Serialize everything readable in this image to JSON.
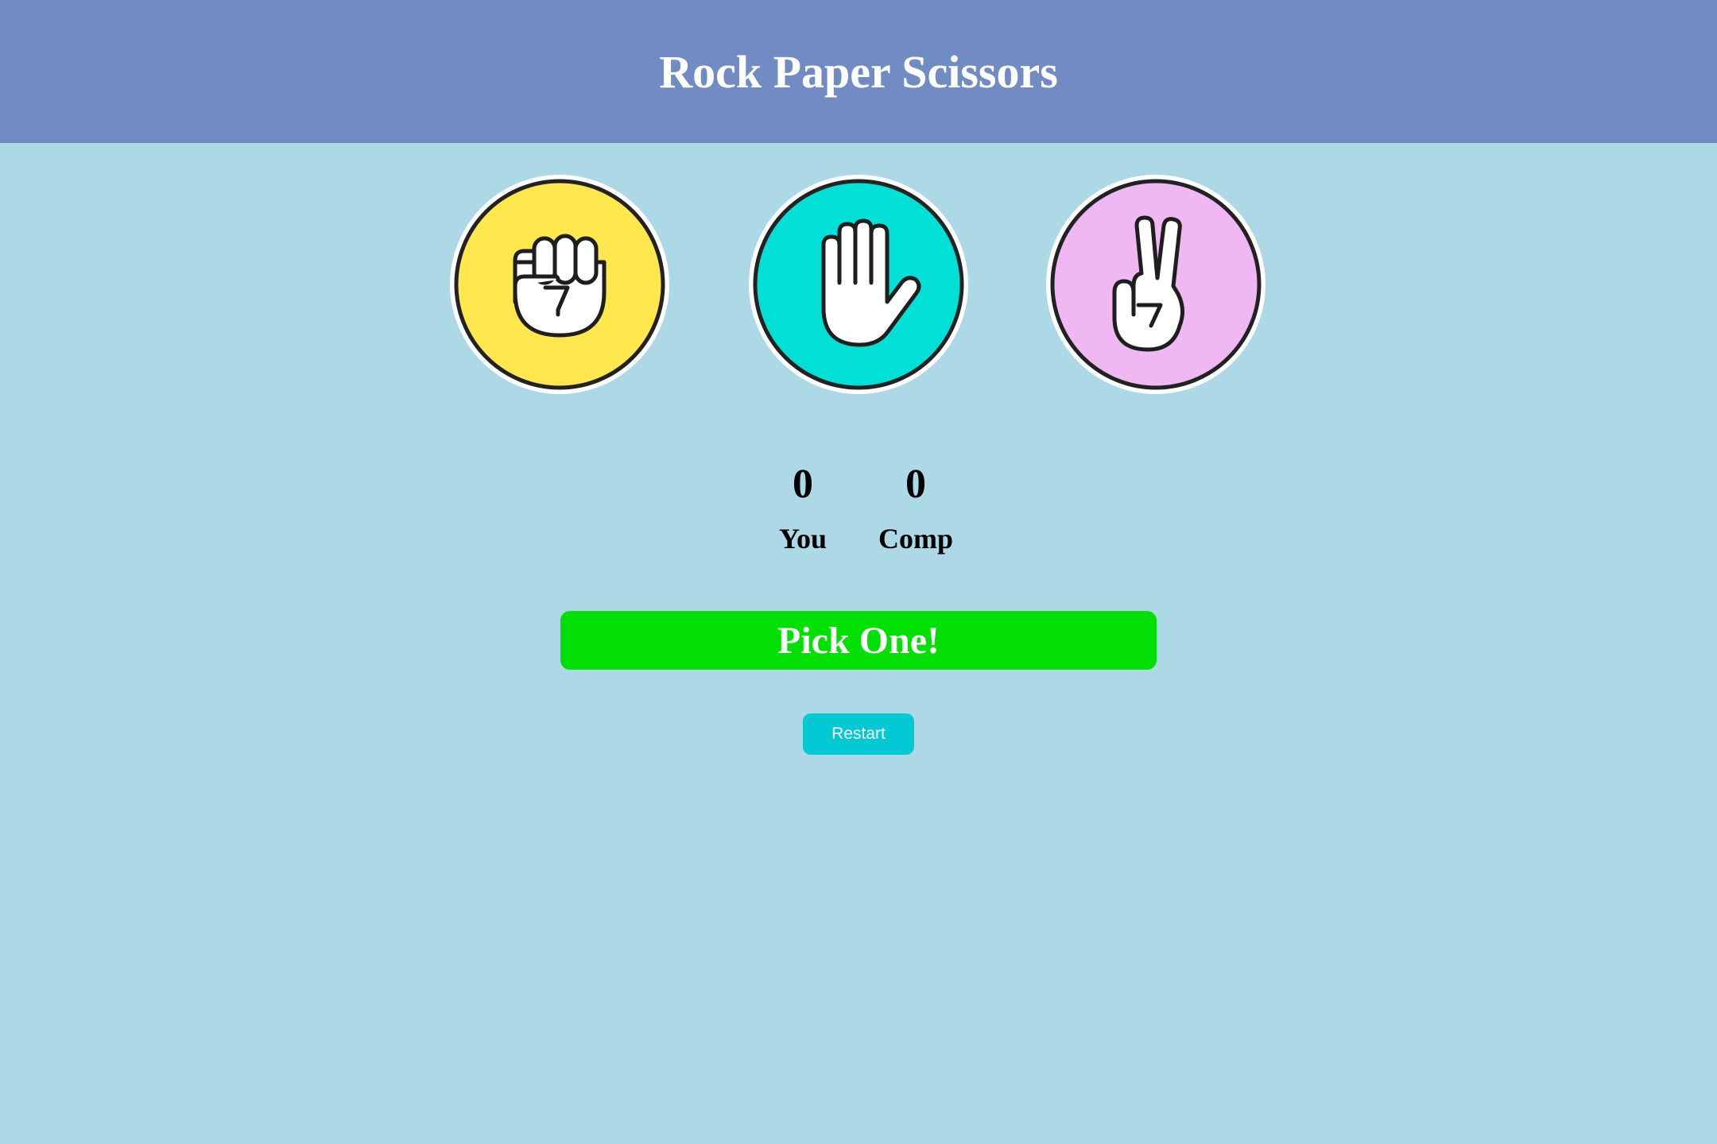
{
  "header": {
    "title": "Rock Paper Scissors",
    "background": "#718cc2"
  },
  "page": {
    "background": "#add8e6"
  },
  "choices": [
    {
      "id": "rock",
      "icon": "fist-icon",
      "color": "#ffe74e"
    },
    {
      "id": "paper",
      "icon": "open-hand-icon",
      "color": "#00e0d6"
    },
    {
      "id": "scissors",
      "icon": "peace-hand-icon",
      "color": "#f0b8f3"
    }
  ],
  "score": {
    "you": {
      "value": "0",
      "label": "You"
    },
    "comp": {
      "value": "0",
      "label": "Comp"
    }
  },
  "result": {
    "text": "Pick One!",
    "color": "#02df04"
  },
  "controls": {
    "restart_label": "Restart",
    "restart_color": "#00c9d4"
  }
}
